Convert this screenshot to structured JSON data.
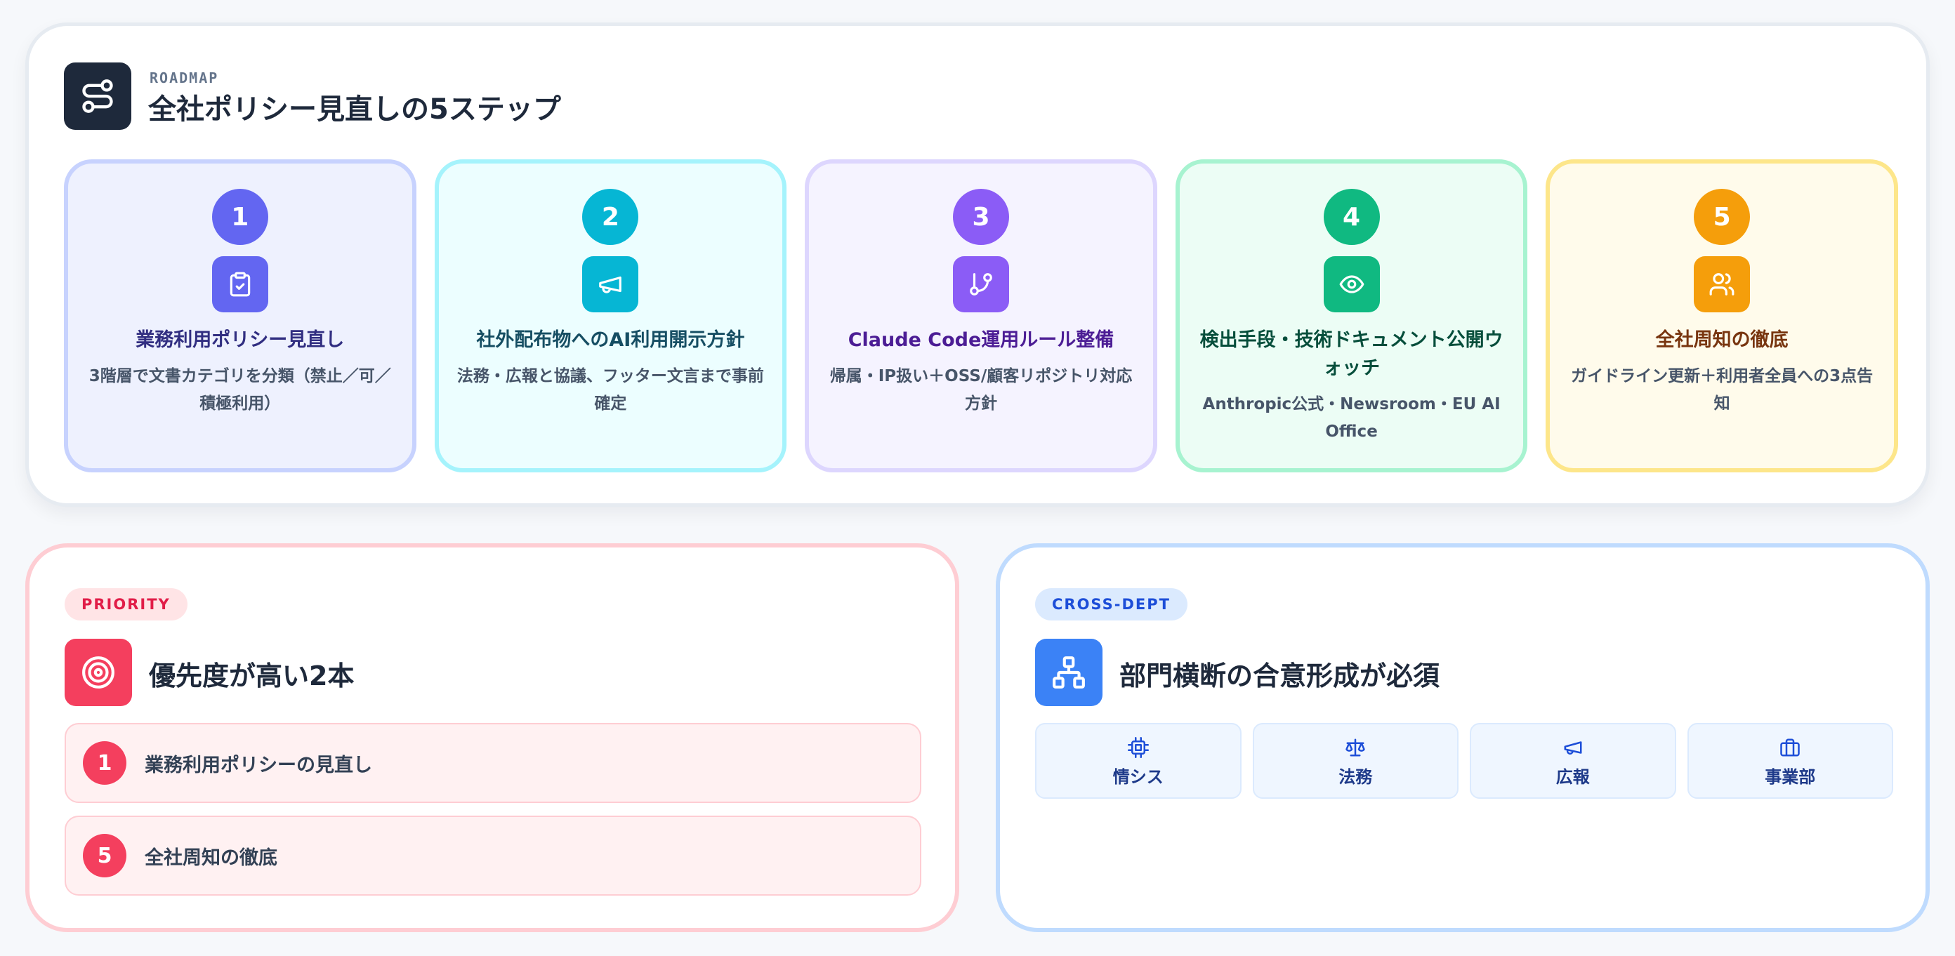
{
  "roadmap": {
    "eyebrow": "ROADMAP",
    "title": "全社ポリシー見直しの5ステップ",
    "icon": "route-icon",
    "steps": [
      {
        "number": "1",
        "icon": "clipboard-check-icon",
        "title": "業務利用ポリシー見直し",
        "description": "3階層で文書カテゴリを分類（禁止／可／積極利用）",
        "accent": "#6366f1",
        "bg": "#eef1fe",
        "border": "#c7d2fe",
        "title_color": "#312e81"
      },
      {
        "number": "2",
        "icon": "megaphone-icon",
        "title": "社外配布物へのAI利用開示方針",
        "description": "法務・広報と協議、フッター文言まで事前確定",
        "accent": "#06b6d4",
        "bg": "#ecfeff",
        "border": "#a5f3fc",
        "title_color": "#164e63"
      },
      {
        "number": "3",
        "icon": "git-branch-icon",
        "title": "Claude Code運用ルール整備",
        "description": "帰属・IP扱い＋OSS/顧客リポジトリ対応方針",
        "accent": "#8b5cf6",
        "bg": "#f5f3ff",
        "border": "#ddd6fe",
        "title_color": "#4c1d95"
      },
      {
        "number": "4",
        "icon": "eye-icon",
        "title": "検出手段・技術ドキュメント公開ウォッチ",
        "description": "Anthropic公式・Newsroom・EU AI Office",
        "accent": "#10b981",
        "bg": "#ecfdf5",
        "border": "#a7f3d0",
        "title_color": "#064e3b"
      },
      {
        "number": "5",
        "icon": "users-icon",
        "title": "全社周知の徹底",
        "description": "ガイドライン更新＋利用者全員への3点告知",
        "accent": "#f59e0b",
        "bg": "#fffbeb",
        "border": "#fde68a",
        "title_color": "#78350f"
      }
    ]
  },
  "priority": {
    "pill": "PRIORITY",
    "icon": "target-icon",
    "title": "優先度が高い2本",
    "items": [
      {
        "number": "1",
        "label": "業務利用ポリシーの見直し"
      },
      {
        "number": "5",
        "label": "全社周知の徹底"
      }
    ]
  },
  "cross_dept": {
    "pill": "CROSS-DEPT",
    "icon": "org-chart-icon",
    "title": "部門横断の合意形成が必須",
    "departments": [
      {
        "icon": "cpu-icon",
        "label": "情シス"
      },
      {
        "icon": "scale-icon",
        "label": "法務"
      },
      {
        "icon": "megaphone-icon",
        "label": "広報"
      },
      {
        "icon": "briefcase-icon",
        "label": "事業部"
      }
    ]
  },
  "colors": {
    "priority_accent": "#f43f5e",
    "cross_dept_accent": "#3b82f6",
    "dark": "#1e293b"
  }
}
